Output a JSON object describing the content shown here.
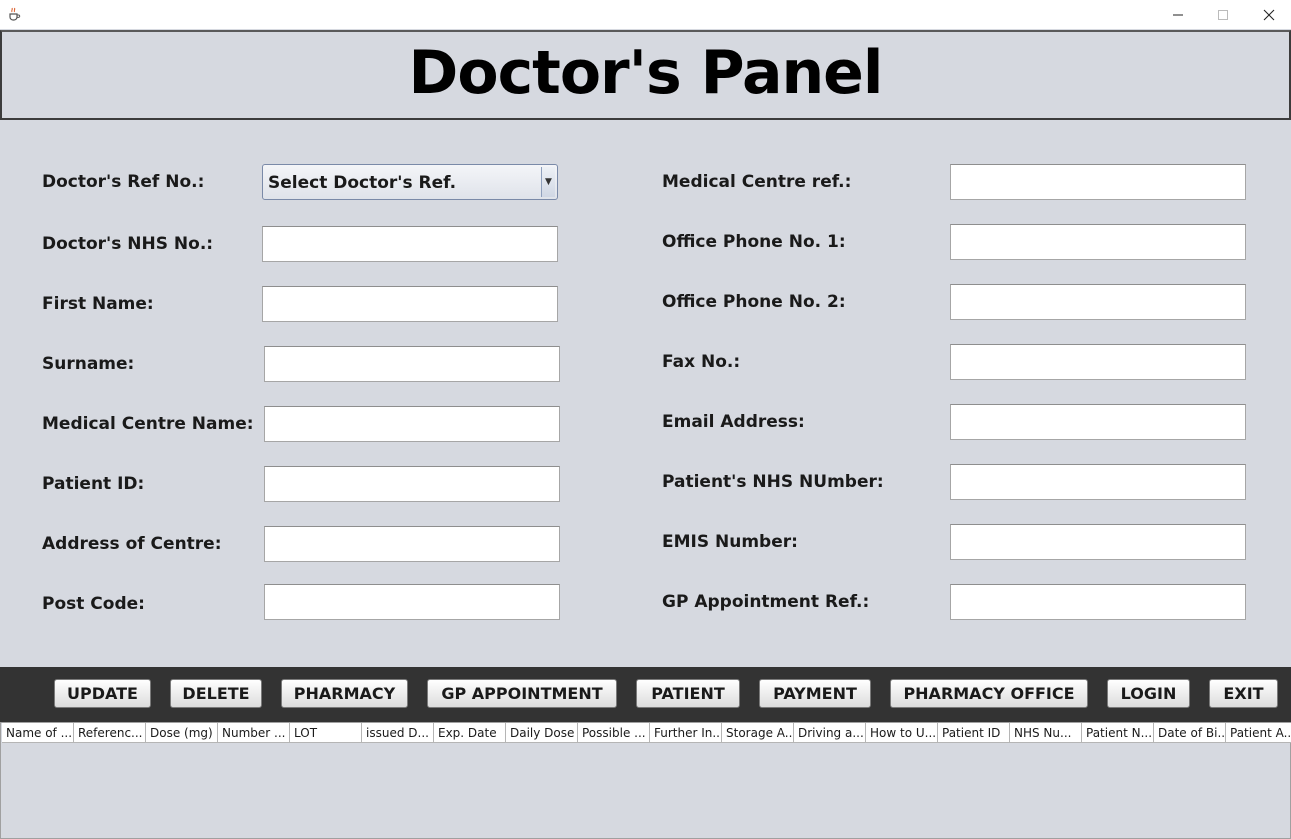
{
  "window": {
    "icon": "java-cup-icon",
    "controls": [
      "minimize-icon",
      "maximize-icon",
      "close-icon"
    ]
  },
  "header": {
    "title": "Doctor's Panel"
  },
  "left_form": {
    "doctor_ref_label": "Doctor's Ref No.:",
    "doctor_ref_selected": "Select Doctor's Ref.",
    "doctor_nhs_label": "Doctor's NHS No.:",
    "first_name_label": "First Name:",
    "surname_label": "Surname:",
    "medical_centre_name_label": "Medical Centre Name:",
    "patient_id_label": "Patient ID:",
    "address_label": "Address of Centre:",
    "post_code_label": "Post Code:"
  },
  "right_form": {
    "medical_centre_ref_label": "Medical Centre ref.:",
    "office_phone1_label": "Office Phone No. 1:",
    "office_phone2_label": "Office Phone No. 2:",
    "fax_label": "Fax No.:",
    "email_label": "Email Address:",
    "patient_nhs_label": "Patient's NHS NUmber:",
    "emis_label": "EMIS Number:",
    "gp_appointment_ref_label": "GP Appointment Ref.:"
  },
  "buttons": {
    "update": "UPDATE",
    "delete": "DELETE",
    "pharmacy": "PHARMACY",
    "gp_appointment": "GP APPOINTMENT",
    "patient": "PATIENT",
    "payment": "PAYMENT",
    "pharmacy_office": "PHARMACY OFFICE",
    "login": "LOGIN",
    "exit": "EXIT"
  },
  "table": {
    "columns": [
      "Name of ...",
      "Referenc...",
      "Dose (mg)",
      "Number ...",
      "LOT",
      "issued D...",
      "Exp. Date",
      "Daily Dose",
      "Possible ...",
      "Further In...",
      "Storage A...",
      "Driving a...",
      "How to U...",
      "Patient ID",
      "NHS Nu...",
      "Patient N...",
      "Date of Bi...",
      "Patient A..."
    ]
  }
}
